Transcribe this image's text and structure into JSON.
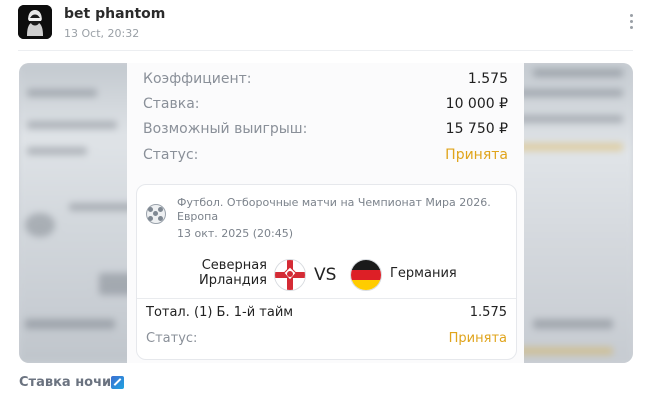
{
  "post": {
    "author": "bet phantom",
    "time": "13 Oct, 20:32",
    "caption": "Ставка ночи!"
  },
  "icons": [
    "avatar-hooded-figure-icon",
    "more-vertical-icon",
    "soccer-ball-icon",
    "northern-ireland-flag-icon",
    "germany-flag-icon",
    "pencil-emoji-icon"
  ],
  "colors": {
    "accepted": "#e0a41c",
    "label": "#8a9099",
    "divider": "#eceef1"
  },
  "receipt": {
    "rows": [
      {
        "label": "Коэффициент:",
        "value": "1.575"
      },
      {
        "label": "Ставка:",
        "value": "10 000 ₽"
      },
      {
        "label": "Возможный выигрыш:",
        "value": "15 750 ₽"
      },
      {
        "label": "Статус:",
        "value": "Принята"
      }
    ],
    "event": {
      "league": "Футбол. Отборочные матчи на Чемпионат Мира 2026. Европа",
      "date": "13 окт. 2025 (20:45)",
      "team1": "Северная Ирландия",
      "vs": "VS",
      "team2": "Германия",
      "market": "Тотал. (1) Б. 1-й тайм",
      "odd": "1.575",
      "status_label": "Статус:",
      "status_value": "Принята"
    }
  }
}
